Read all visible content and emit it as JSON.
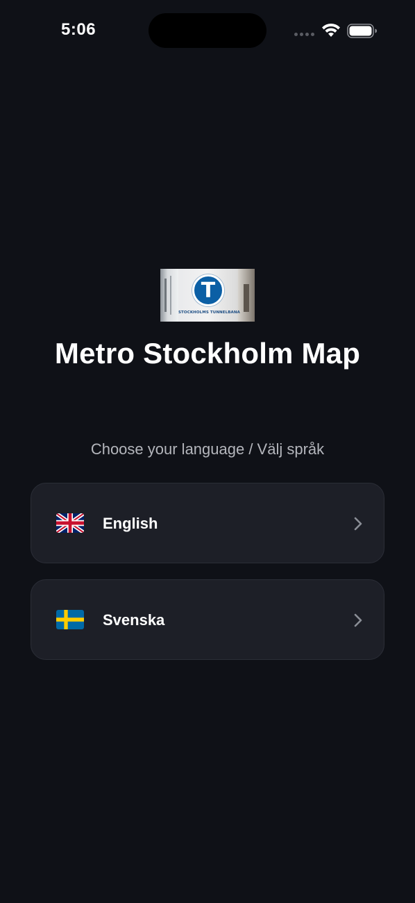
{
  "status_bar": {
    "time": "5:06"
  },
  "logo": {
    "sign_letter": "T",
    "sign_text": "STOCKHOLMS TUNNELBANA"
  },
  "app": {
    "title": "Metro Stockholm Map",
    "subtitle": "Choose your language / Välj språk"
  },
  "languages": [
    {
      "label": "English",
      "flag": "uk-flag-icon"
    },
    {
      "label": "Svenska",
      "flag": "sweden-flag-icon"
    }
  ],
  "colors": {
    "background": "#0f1117",
    "card": "#1d1f27",
    "sign_blue": "#0b5fa5"
  }
}
